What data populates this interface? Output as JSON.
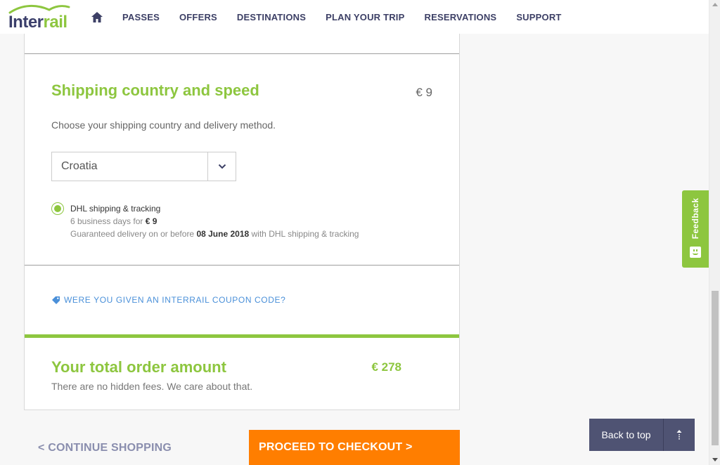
{
  "brand": {
    "name_part1": "Inter",
    "name_part2": "rail",
    "primary": "#3b3f6b",
    "accent": "#8dc63f",
    "cta": "#ff7e00"
  },
  "nav": {
    "home_icon": "home-icon",
    "items": [
      {
        "label": "PASSES"
      },
      {
        "label": "OFFERS"
      },
      {
        "label": "DESTINATIONS"
      },
      {
        "label": "PLAN YOUR TRIP"
      },
      {
        "label": "RESERVATIONS"
      },
      {
        "label": "SUPPORT"
      }
    ]
  },
  "shipping": {
    "title": "Shipping country and speed",
    "price": "€ 9",
    "description": "Choose your shipping country and delivery method.",
    "country": {
      "selected": "Croatia",
      "icon": "chevron-down-icon"
    },
    "option": {
      "title": "DHL shipping & tracking",
      "days_prefix": "6 business days for",
      "days_price": "€ 9",
      "guarantee_prefix": "Guaranteed delivery on or before",
      "guarantee_date": "08 June 2018",
      "guarantee_suffix": "with DHL shipping & tracking",
      "selected": true
    }
  },
  "coupon": {
    "label": "WERE YOU GIVEN AN INTERRAIL COUPON CODE?",
    "icon": "tag-icon"
  },
  "total": {
    "title": "Your total order amount",
    "price": "€ 278",
    "description": "There are no hidden fees. We care about that."
  },
  "actions": {
    "continue_label": "< CONTINUE SHOPPING",
    "checkout_label": "PROCEED TO CHECKOUT >"
  },
  "back_to_top": {
    "label": "Back to top",
    "icon": "arrow-up-icon"
  },
  "feedback": {
    "label": "Feedback",
    "icon": "smiley-icon"
  }
}
